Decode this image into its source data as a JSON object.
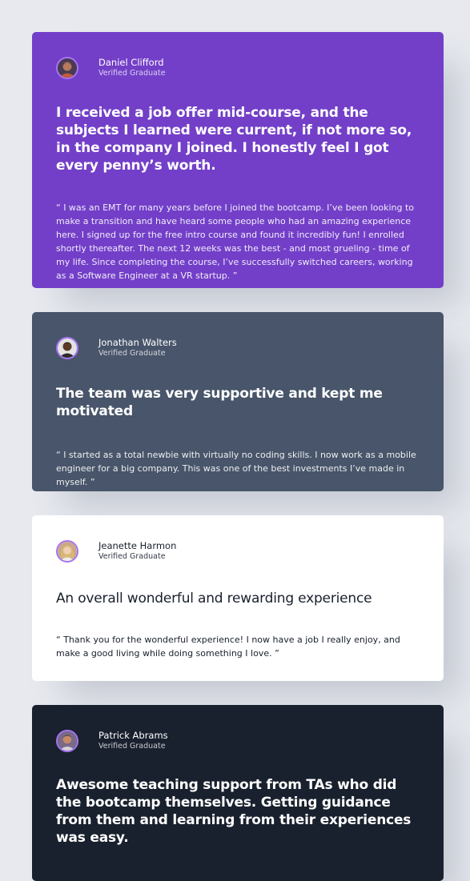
{
  "testimonials": [
    {
      "name": "Daniel Clifford",
      "status": "Verified Graduate",
      "headline": "I received a job offer mid-course, and the subjects I learned were current, if not more so, in the company I joined. I honestly feel I got every penny’s worth.",
      "quote": "“ I was an EMT for many years before I joined the bootcamp. I’ve been looking to make a transition and have heard some people who had an amazing experience here. I signed up for the free intro course and found it incredibly fun! I enrolled shortly thereafter. The next 12 weeks was the best - and most grueling - time of my life. Since completing the course, I’ve successfully switched careers, working as a Software Engineer at a VR startup. ”",
      "card_color": "#733fc8"
    },
    {
      "name": "Jonathan Walters",
      "status": "Verified Graduate",
      "headline": "The team was very supportive and kept me motivated",
      "quote": "“ I started as a total newbie with virtually no coding skills. I now work as a mobile engineer for a big company. This was one of the best investments I’ve made in myself. ”",
      "card_color": "#48556a"
    },
    {
      "name": "Jeanette Harmon",
      "status": "Verified Graduate",
      "headline": "An overall wonderful and rewarding experience",
      "quote": "“ Thank you for the wonderful experience! I now have a job I really enjoy, and make a good living while doing something I love. ”",
      "card_color": "#ffffff"
    },
    {
      "name": "Patrick Abrams",
      "status": "Verified Graduate",
      "headline": "Awesome teaching support from TAs who did the bootcamp themselves. Getting guidance from them and learning from their experiences was easy.",
      "card_color": "#19212e"
    }
  ],
  "colors": {
    "page_background": "#e7e9ef",
    "avatar_ring": "#a775f1"
  }
}
